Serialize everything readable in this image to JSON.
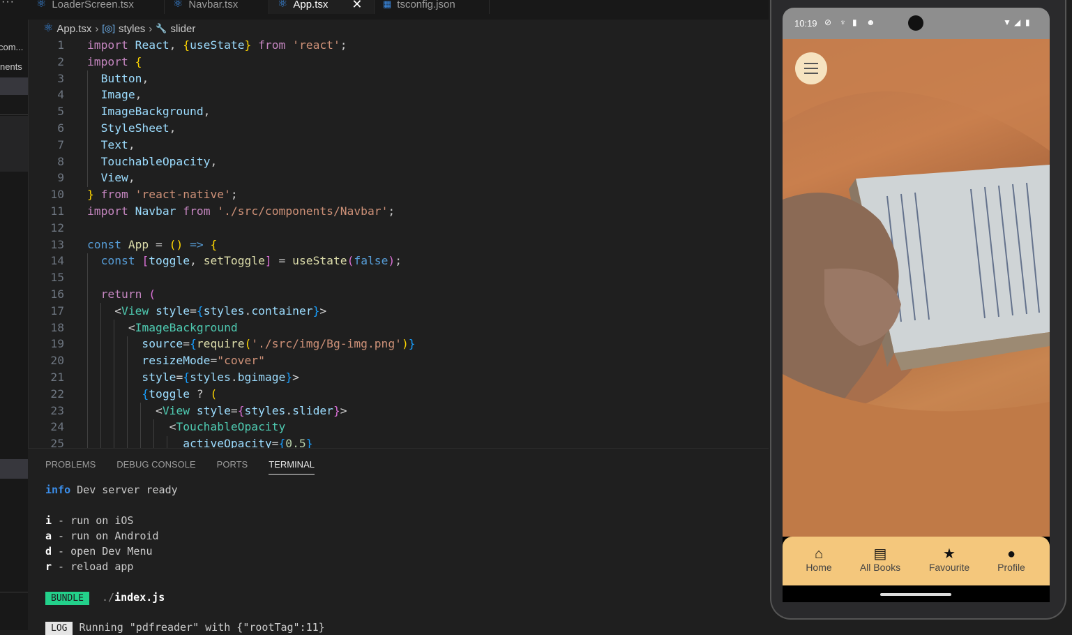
{
  "side": {
    "dots": "···",
    "t1": "com...",
    "t2": "nents"
  },
  "tabs": [
    {
      "label": "LoaderScreen.tsx"
    },
    {
      "label": "Navbar.tsx"
    },
    {
      "label": "App.tsx",
      "close": "✕"
    },
    {
      "label": "tsconfig.json"
    }
  ],
  "breadcrumb": {
    "file": "App.tsx",
    "sym1": "styles",
    "sym2": "slider"
  },
  "code": {
    "line_numbers": [
      "1",
      "2",
      "3",
      "4",
      "5",
      "6",
      "7",
      "8",
      "9",
      "10",
      "11",
      "12",
      "13",
      "14",
      "15",
      "16",
      "17",
      "18",
      "19",
      "20",
      "21",
      "22",
      "23",
      "24",
      "25"
    ]
  },
  "panel": {
    "tabs": [
      "PROBLEMS",
      "DEBUG CONSOLE",
      "PORTS",
      "TERMINAL"
    ],
    "info_tag": "info",
    "info_text": " Dev server ready",
    "cmds": [
      {
        "key": "i",
        "text": " - run on iOS"
      },
      {
        "key": "a",
        "text": " - run on Android"
      },
      {
        "key": "d",
        "text": " - open Dev Menu"
      },
      {
        "key": "r",
        "text": " - reload app"
      }
    ],
    "bundle_tag": "BUNDLE",
    "bundle_path_dim": "./",
    "bundle_path": "index.js",
    "log_tag": "LOG",
    "log_text": "Running \"pdfreader\" with {\"rootTag\":11}"
  },
  "phone": {
    "time": "10:19",
    "nav": [
      {
        "label": "Home",
        "icon": "home-icon"
      },
      {
        "label": "All Books",
        "icon": "book-icon"
      },
      {
        "label": "Favourite",
        "icon": "star-icon"
      },
      {
        "label": "Profile",
        "icon": "person-icon"
      }
    ]
  },
  "colors": {
    "accent": "#3b8eea",
    "nav_bg": "#f4c77c",
    "robe": "#c97f4d"
  }
}
